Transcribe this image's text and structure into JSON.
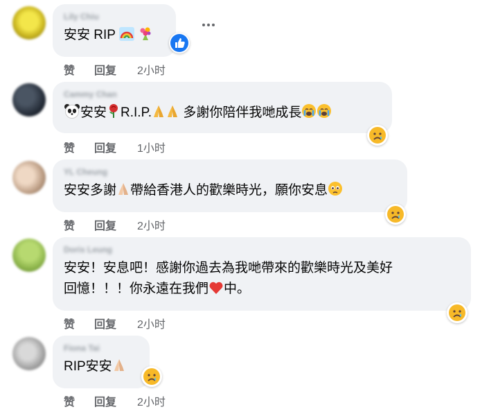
{
  "comments": [
    {
      "author": "Lily Chiu",
      "text_before": "安安 RIP",
      "text_after": "",
      "emojis": [
        "rainbow-emoji",
        "bouquet-emoji"
      ],
      "reaction": "like-reaction-icon",
      "actions": {
        "like": "赞",
        "reply": "回复",
        "time": "2小时"
      }
    },
    {
      "author": "Cammy Chan",
      "text": "安安 R.I.P. 多謝你陪伴我哋成長",
      "segments": [
        "安安",
        "R.I.P.",
        "多謝你陪伴我哋成長"
      ],
      "reaction": "sad-reaction-icon",
      "actions": {
        "like": "赞",
        "reply": "回复",
        "time": "1小时"
      }
    },
    {
      "author": "YL Cheung",
      "segments": [
        "安安多謝",
        "帶給香港人的歡樂時光，願你安息"
      ],
      "reaction": "sad-reaction-icon",
      "actions": {
        "like": "赞",
        "reply": "回复",
        "time": "2小时"
      }
    },
    {
      "author": "Doris Leung",
      "line1": "安安！安息吧！感謝你過去為我哋帶來的歡樂時光及美好",
      "line2_before": "回憶！！！你永遠在我們",
      "line2_after": "中。",
      "reaction": "sad-reaction-icon",
      "actions": {
        "like": "赞",
        "reply": "回复",
        "time": "2小时"
      }
    },
    {
      "author": "Fiona Tai",
      "segments": [
        "RIP安安"
      ],
      "reaction": "sad-reaction-icon",
      "actions": {
        "like": "赞",
        "reply": "回复",
        "time": "2小时"
      }
    }
  ],
  "colors": {
    "bubble": "#f0f2f5",
    "action_text": "#65676b",
    "like_blue": "#1877f2"
  }
}
